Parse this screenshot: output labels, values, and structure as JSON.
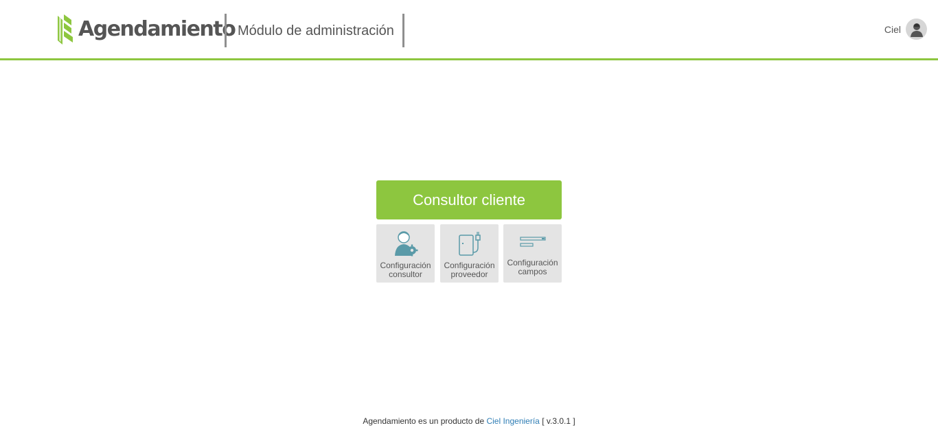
{
  "header": {
    "brand": "Agendamiento",
    "module_title": "Módulo de administración",
    "user_name": "Ciel",
    "accent_color": "#8dc63f"
  },
  "main": {
    "primary_button": "Consultor cliente",
    "tiles": [
      {
        "line1": "Configuración",
        "line2": "consultor",
        "icon": "user-gear-icon"
      },
      {
        "line1": "Configuración",
        "line2": "proveedor",
        "icon": "device-plug-icon"
      },
      {
        "line1": "Configuración",
        "line2": "campos",
        "icon": "form-fields-icon"
      }
    ]
  },
  "footer": {
    "prefix": "Agendamiento es un producto de",
    "company_link": "Ciel Ingeniería",
    "version": "[ v.3.0.1 ]"
  }
}
